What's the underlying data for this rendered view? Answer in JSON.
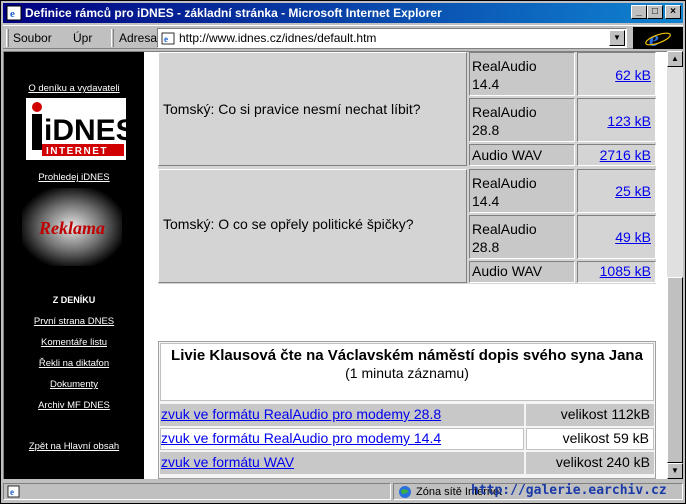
{
  "window": {
    "title": "Definice rámců pro iDNES - základní stránka - Microsoft Internet Explorer",
    "controls": {
      "minimize": "_",
      "maximize": "□",
      "close": "×"
    }
  },
  "toolbar": {
    "menu_soubor": "Soubor",
    "menu_upr": "Úpr",
    "address_label": "Adresa",
    "address_url": "http://www.idnes.cz/idnes/default.htm"
  },
  "left_nav": {
    "about": "O deníku a vydavateli",
    "logo_text": "iDNES",
    "logo_sub": "INTERNET",
    "browse": "Prohledej iDNES",
    "reklama": "Reklama",
    "section_title": "Z DENÍKU",
    "items": [
      {
        "label": "První strana DNES"
      },
      {
        "label": "Komentáře listu"
      },
      {
        "label": "Řekli na diktafon"
      },
      {
        "label": "Dokumenty"
      },
      {
        "label": "Archiv MF DNES"
      }
    ],
    "back": "Zpět na Hlavní obsah"
  },
  "audio_blocks": [
    {
      "title": "Tomský: Co si pravice nesmí nechat líbit?",
      "rows": [
        {
          "format": "RealAudio 14.4",
          "size": "62 kB"
        },
        {
          "format": "RealAudio 28.8",
          "size": "123 kB"
        },
        {
          "format": "Audio WAV",
          "size": "2716 kB"
        }
      ]
    },
    {
      "title": "Tomský: O co se opřely politické špičky?",
      "rows": [
        {
          "format": "RealAudio 14.4",
          "size": "25 kB"
        },
        {
          "format": "RealAudio 28.8",
          "size": "49 kB"
        },
        {
          "format": "Audio WAV",
          "size": "1085 kB"
        }
      ]
    }
  ],
  "klausova": {
    "title": "Livie Klausová čte na Václavském náměstí dopis svého syna Jana",
    "subtitle": "(1 minuta záznamu)",
    "rows": [
      {
        "link": "zvuk ve formátu RealAudio pro modemy 28.8",
        "size": "velikost 112kB"
      },
      {
        "link": "zvuk ve formátu RealAudio pro modemy 14.4",
        "size": "velikost 59 kB"
      },
      {
        "link": "zvuk ve formátu WAV",
        "size": "velikost 240 kB"
      }
    ]
  },
  "status": {
    "zone": "Zóna sítě Internet",
    "watermark": "http://galerie.earchiv.cz"
  },
  "colors": {
    "title_start": "#000080",
    "title_end": "#1084d0",
    "link": "#0000ee"
  }
}
